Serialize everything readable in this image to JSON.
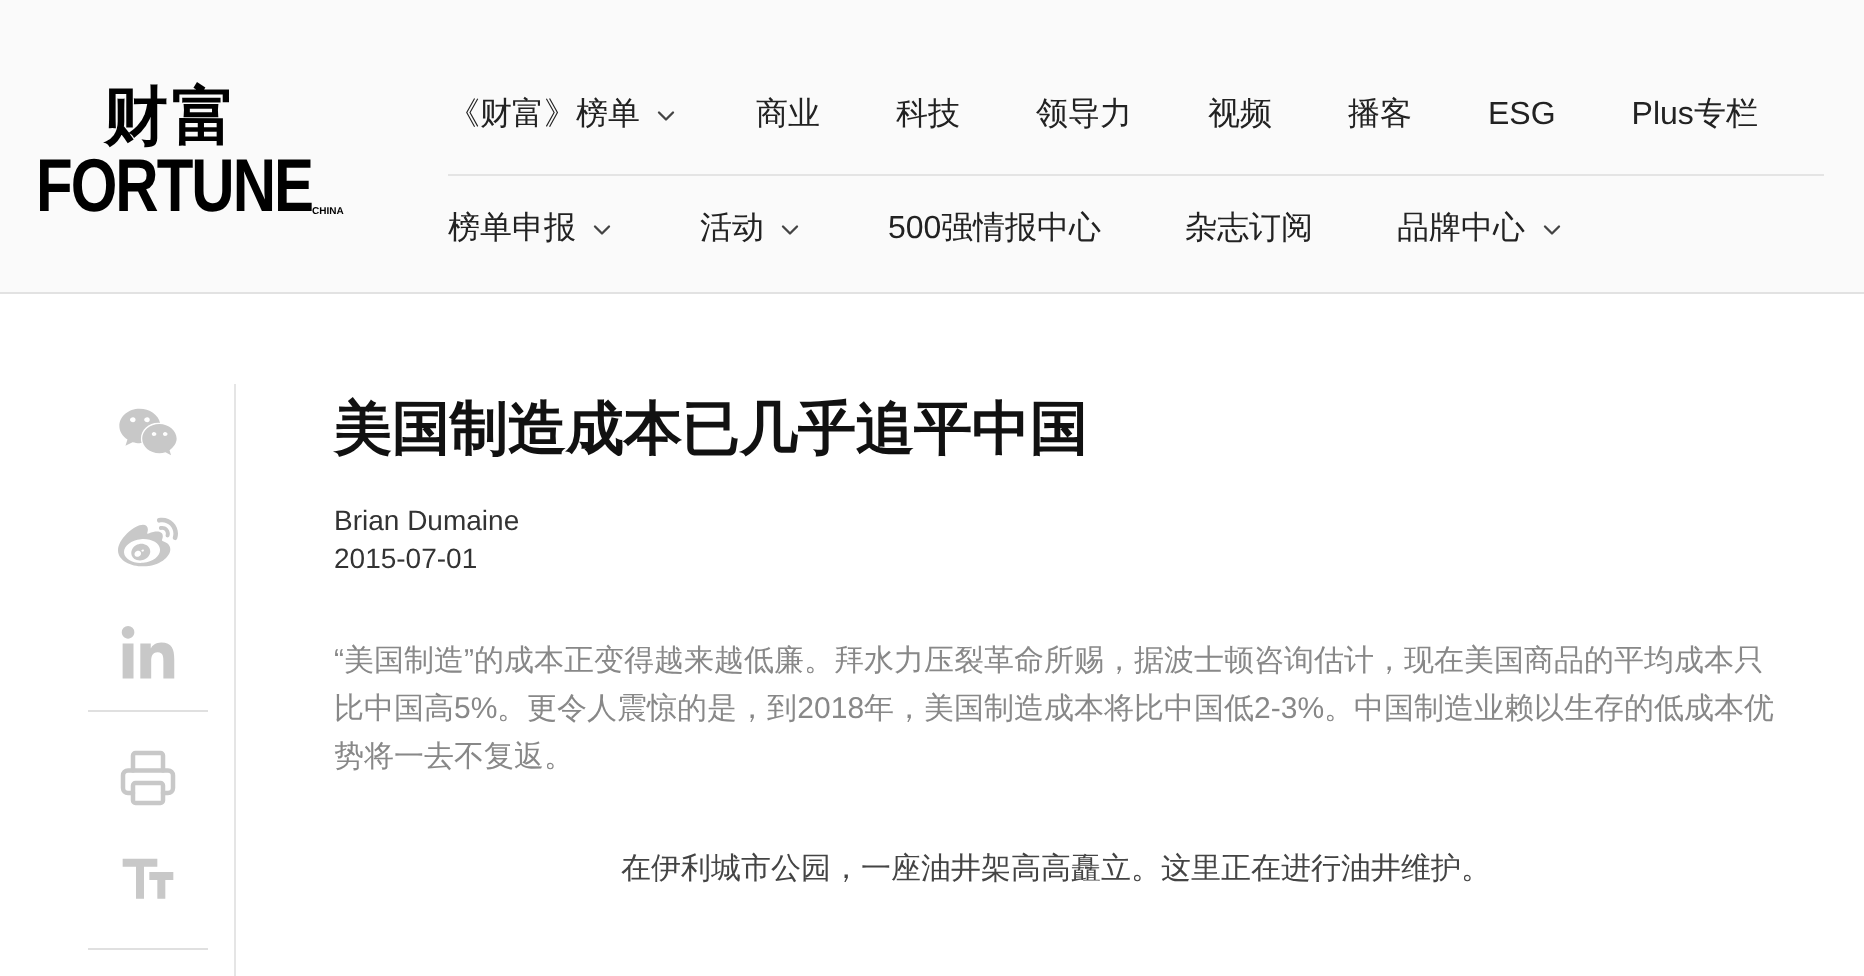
{
  "logo": {
    "chinese": "财富",
    "wordmark": "FORTUNE",
    "edition": "CHINA"
  },
  "nav_rows": [
    [
      {
        "label": "《财富》榜单",
        "dropdown": true
      },
      {
        "label": "商业",
        "dropdown": false
      },
      {
        "label": "科技",
        "dropdown": false
      },
      {
        "label": "领导力",
        "dropdown": false
      },
      {
        "label": "视频",
        "dropdown": false
      },
      {
        "label": "播客",
        "dropdown": false
      },
      {
        "label": "ESG",
        "dropdown": false
      },
      {
        "label": "Plus专栏",
        "dropdown": false
      }
    ],
    [
      {
        "label": "榜单申报",
        "dropdown": true
      },
      {
        "label": "活动",
        "dropdown": true
      },
      {
        "label": "500强情报中心",
        "dropdown": false
      },
      {
        "label": "杂志订阅",
        "dropdown": false
      },
      {
        "label": "品牌中心",
        "dropdown": true
      }
    ]
  ],
  "article": {
    "title": "美国制造成本已几乎追平中国",
    "author": "Brian Dumaine",
    "date": "2015-07-01",
    "summary": "“美国制造”的成本正变得越来越低廉。拜水力压裂革命所赐，据波士顿咨询估计，现在美国商品的平均成本只比中国高5%。更令人震惊的是，到2018年，美国制造成本将比中国低2-3%。中国制造业赖以生存的低成本优势将一去不复返。",
    "caption": "在伊利城市公园，一座油井架高高矗立。这里正在进行油井维护。"
  }
}
